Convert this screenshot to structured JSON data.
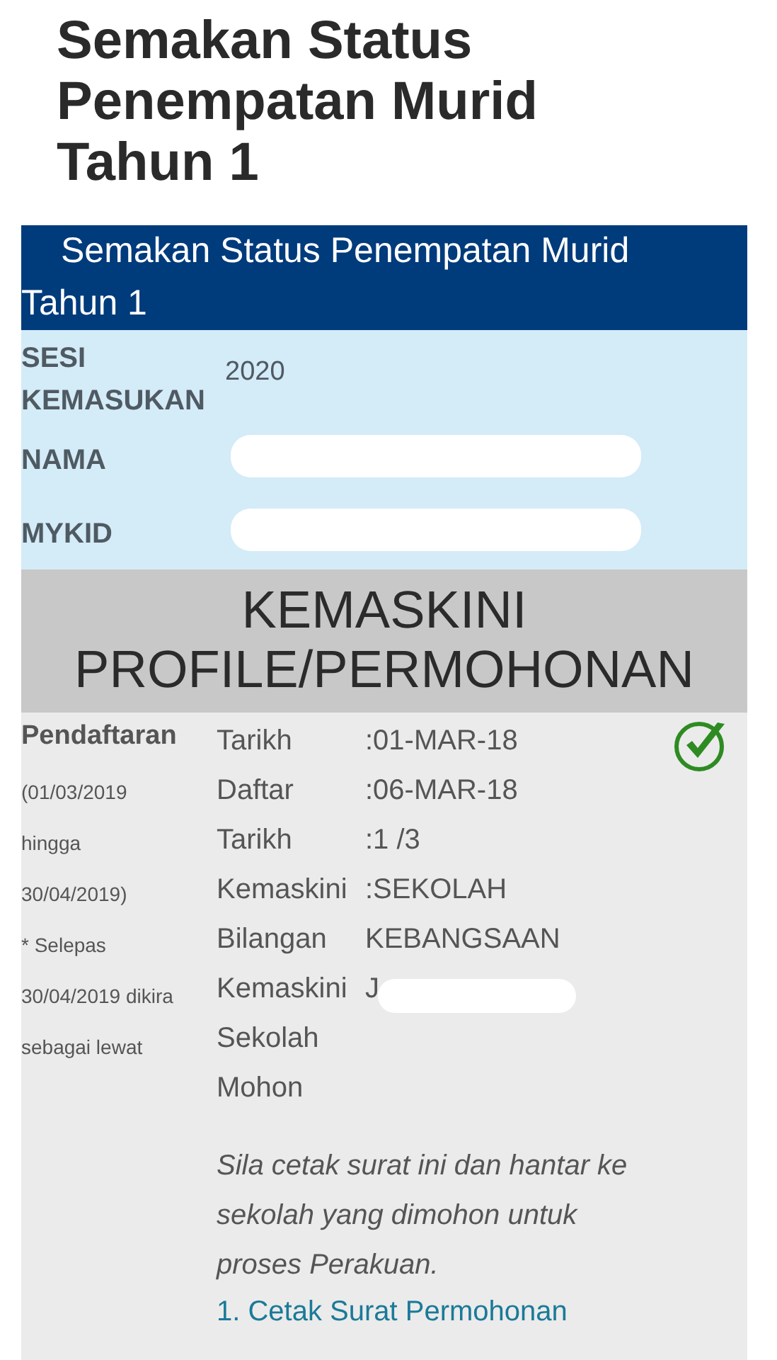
{
  "page_title": "Semakan Status Penempatan Murid Tahun 1",
  "panel": {
    "title": "Semakan Status Penempatan Murid Tahun 1",
    "fields": [
      {
        "label": "SESI KEMASUKAN",
        "value": "2020",
        "redacted": false
      },
      {
        "label": "NAMA",
        "redacted": true
      },
      {
        "label": "MYKID",
        "redacted": true
      }
    ]
  },
  "update": {
    "heading": "KEMASKINI PROFILE/PERMOHONAN",
    "stage": {
      "title": "Pendaftaran",
      "notes": [
        "(01/03/2019",
        "hingga",
        "30/04/2019)",
        "* Selepas",
        "30/04/2019 dikira",
        "sebagai lewat"
      ]
    },
    "lines": [
      {
        "label": "Tarikh",
        "value": ":01-MAR-18",
        "redacted": false
      },
      {
        "label": "Daftar",
        "value": ":06-MAR-18",
        "redacted": false
      },
      {
        "label": "Tarikh",
        "value": ":1 /3",
        "redacted": false
      },
      {
        "label": "Kemaskini",
        "value": ":SEKOLAH",
        "redacted": false
      },
      {
        "label": "Bilangan",
        "value": "KEBANGSAAN",
        "redacted": false
      },
      {
        "label": "Kemaskini",
        "value": "J",
        "redacted": true
      },
      {
        "label": "Sekolah",
        "redacted": false
      },
      {
        "label": "Mohon",
        "redacted": false
      }
    ],
    "completed": true,
    "instruction": "Sila cetak surat ini dan hantar ke sekolah yang dimohon untuk proses Perakuan.",
    "link": "1. Cetak Surat Permohonan"
  }
}
